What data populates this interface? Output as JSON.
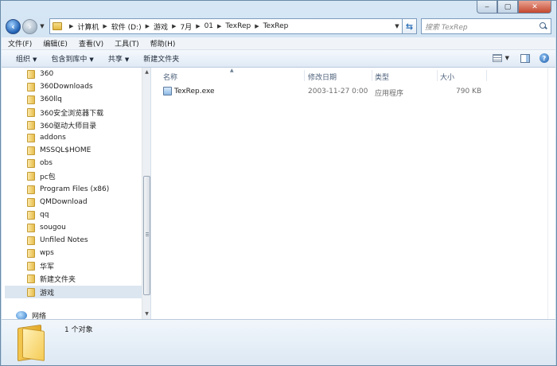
{
  "address": {
    "crumbs": [
      "计算机",
      "软件 (D:)",
      "游戏",
      "7月",
      "01",
      "TexRep",
      "TexRep"
    ]
  },
  "search": {
    "placeholder": "搜索 TexRep"
  },
  "menu": [
    "文件(F)",
    "编辑(E)",
    "查看(V)",
    "工具(T)",
    "帮助(H)"
  ],
  "toolbar": {
    "organize": "组织",
    "include_library": "包含到库中",
    "share": "共享",
    "new_folder": "新建文件夹"
  },
  "nav": {
    "items": [
      "360",
      "360Downloads",
      "360llq",
      "360安全浏览器下载",
      "360驱动大师目录",
      "addons",
      "MSSQL$HOME",
      "obs",
      "pc包",
      "Program Files (x86)",
      "QMDownload",
      "qq",
      "sougou",
      "Unfiled Notes",
      "wps",
      "华军",
      "新建文件夹",
      "游戏"
    ],
    "selected": "游戏",
    "network": "网络"
  },
  "columns": {
    "name": "名称",
    "modified": "修改日期",
    "type": "类型",
    "size": "大小"
  },
  "files": [
    {
      "name": "TexRep.exe",
      "modified": "2003-11-27 0:00",
      "type": "应用程序",
      "size": "790 KB"
    }
  ],
  "details": {
    "count_text": "1 个对象"
  }
}
